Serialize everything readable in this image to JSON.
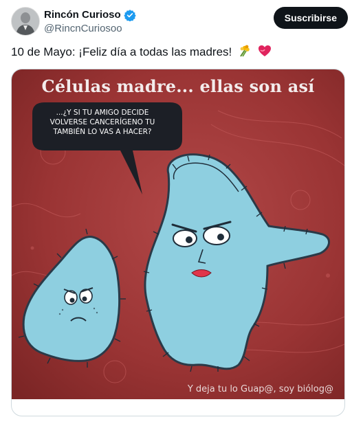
{
  "author": {
    "display_name": "Rincón Curioso",
    "handle": "@RincnCuriosoo"
  },
  "actions": {
    "subscribe_label": "Suscribirse"
  },
  "tweet": {
    "text": "10 de Mayo: ¡Feliz día a todas las madres!",
    "emojis": [
      "bouquet-icon",
      "heart-icon"
    ]
  },
  "media": {
    "title": "Células madre... ellas son así",
    "speech": "...¿y si tu amigo decide volverse cancerígeno tu también lo vas a hacer?",
    "watermark": "Y deja tu lo Guap@, soy biólog@"
  },
  "colors": {
    "accent": "#1d9bf0",
    "button_bg": "#0f1419",
    "meme_background": "#9e3a3a",
    "cell_fill": "#8ecfe0"
  }
}
